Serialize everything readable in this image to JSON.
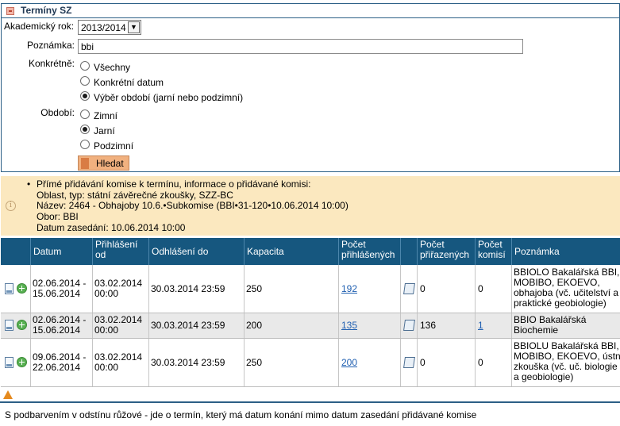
{
  "panel": {
    "title": "Termíny SZ",
    "year_label": "Akademický rok:",
    "year_value": "2013/2014",
    "note_label": "Poznámka:",
    "note_value": "bbi",
    "concrete_label": "Konkrétně:",
    "concrete_options": [
      "Všechny",
      "Konkrétní datum",
      "Výběr období (jarní nebo podzimní)"
    ],
    "concrete_selected": "Výběr období (jarní nebo podzimní)",
    "period_label": "Období:",
    "period_options": [
      "Zimní",
      "Jarní",
      "Podzimní"
    ],
    "period_selected": "Jarní",
    "search_button": "Hledat"
  },
  "info": {
    "bullet": "•",
    "lines": [
      "Přímé přidávání komise k termínu, informace o přidávané komisi:",
      "Oblast, typ: státní závěrečné zkoušky, SZZ-BC",
      "Název: 2464 - Obhajoby 10.6.•Subkomise (BBI•31-120•10.06.2014 10:00)",
      "Obor: BBI",
      "Datum zasedání: 10.06.2014 10:00"
    ]
  },
  "table": {
    "headers": {
      "date": "Datum",
      "signup_from": [
        "Přihlášení",
        "od"
      ],
      "signoff_to": "Odhlášení do",
      "capacity": "Kapacita",
      "registered": [
        "Počet",
        "přihlášených"
      ],
      "assigned": [
        "Počet",
        "přiřazených"
      ],
      "commissions": [
        "Počet",
        "komisí"
      ],
      "note": "Poznámka"
    },
    "rows": [
      {
        "date": [
          "02.06.2014 -",
          "15.06.2014"
        ],
        "signup_from": [
          "03.02.2014",
          "00:00"
        ],
        "signoff_to": "30.03.2014 23:59",
        "capacity": "250",
        "registered": "192",
        "assigned": "0",
        "commissions": "0",
        "note": [
          "BBIOLO Bakalářská BBI,",
          "MOBIBO, EKOEVO,",
          "obhajoba (vč. učitelství a",
          "praktické geobiologie)"
        ]
      },
      {
        "date": [
          "02.06.2014 -",
          "15.06.2014"
        ],
        "signup_from": [
          "03.02.2014",
          "00:00"
        ],
        "signoff_to": "30.03.2014 23:59",
        "capacity": "200",
        "registered": "135",
        "assigned": "136",
        "commissions": "1",
        "note": [
          "BBIO Bakalářská",
          "Biochemie"
        ]
      },
      {
        "date": [
          "09.06.2014 -",
          "22.06.2014"
        ],
        "signup_from": [
          "03.02.2014",
          "00:00"
        ],
        "signoff_to": "30.03.2014 23:59",
        "capacity": "250",
        "registered": "200",
        "assigned": "0",
        "commissions": "0",
        "note": [
          "BBIOLU Bakalářská BBI,",
          "MOBIBO, EKOEVO, ústní",
          "zkouška (vč. uč. biologie",
          "a geobiologie)"
        ]
      }
    ]
  },
  "footer": {
    "note": "S podbarvením v odstínu růžové - jde o termín, který má datum konání mimo datum zasedání přidávané komise"
  },
  "icons": [
    "collapse-icon",
    "info-icon",
    "document-icon",
    "add-icon",
    "sheet-icon",
    "warning-icon"
  ],
  "colors": {
    "header_blue": "#16577f",
    "info_bg": "#fbe8bf",
    "button_orange": "#f1b17f",
    "link_blue": "#1f5fb1",
    "warning_orange": "#e58a1f"
  }
}
